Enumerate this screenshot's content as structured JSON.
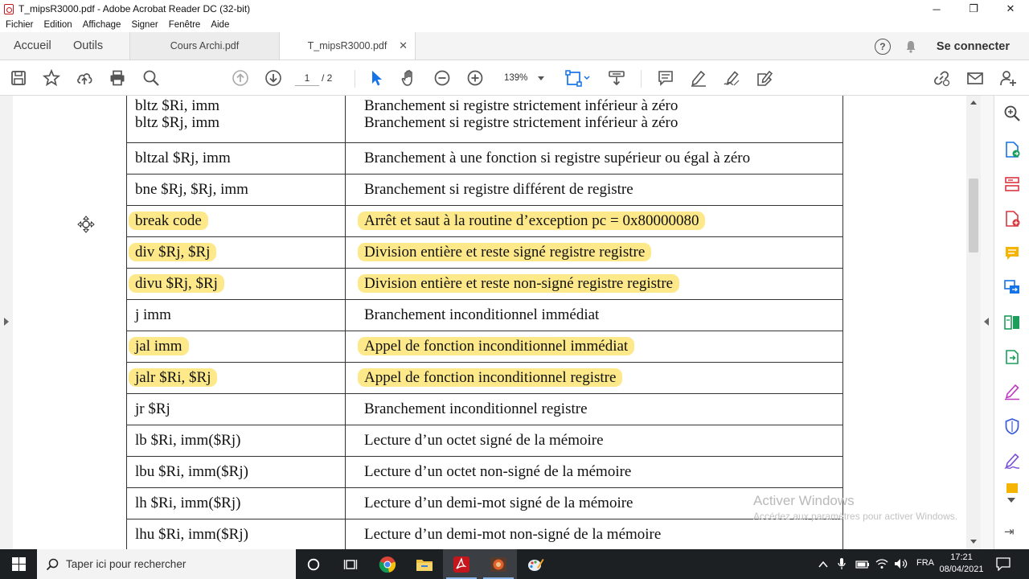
{
  "window": {
    "title": "T_mipsR3000.pdf - Adobe Acrobat Reader DC (32-bit)",
    "minimize": "─",
    "restore": "❐",
    "close": "✕"
  },
  "menu": [
    "Fichier",
    "Edition",
    "Affichage",
    "Signer",
    "Fenêtre",
    "Aide"
  ],
  "tabs": {
    "home": "Accueil",
    "tools": "Outils",
    "doc1": "Cours Archi.pdf",
    "doc2": "T_mipsR3000.pdf",
    "doc2_close": "✕",
    "help": "?",
    "signin": "Se connecter"
  },
  "toolbar": {
    "page_current": "1",
    "page_total": "/ 2",
    "zoom": "139%"
  },
  "table": {
    "rows": [
      {
        "instr": "bltz $Ri, imm",
        "instr2": "bltz $Rj, imm",
        "desc": "Branchement si registre strictement inférieur à zéro",
        "desc2": "Branchement si registre strictement inférieur à zéro",
        "hl": false
      },
      {
        "instr": "bltzal $Rj, imm",
        "desc": "Branchement à une fonction si registre supérieur ou égal à zéro",
        "hl": false
      },
      {
        "instr": "bne $Rj, $Rj, imm",
        "desc": "Branchement si registre différent de registre",
        "hl": false
      },
      {
        "instr": "break code",
        "desc": "Arrêt et saut à la routine d’exception   pc =  0x80000080",
        "hl": true
      },
      {
        "instr": "div $Rj, $Rj",
        "desc": "Division entière et reste signé registre registre",
        "hl": true
      },
      {
        "instr": "divu $Rj, $Rj",
        "desc": "Division entière et reste non-signé registre registre",
        "hl": true
      },
      {
        "instr": "j imm",
        "desc": "Branchement inconditionnel immédiat",
        "hl": false
      },
      {
        "instr": "jal imm",
        "desc": "Appel de fonction inconditionnel immédiat",
        "hl": true
      },
      {
        "instr": "jalr $Ri, $Rj",
        "desc": "Appel de fonction inconditionnel registre",
        "hl": true
      },
      {
        "instr": "jr $Rj",
        "desc": "Branchement inconditionnel registre",
        "hl": false
      },
      {
        "instr": "lb $Ri, imm($Rj)",
        "desc": "Lecture d’un octet signé de la mémoire",
        "hl": false
      },
      {
        "instr": "lbu $Ri, imm($Rj)",
        "desc": "Lecture d’un octet non-signé de la mémoire",
        "hl": false
      },
      {
        "instr": "lh $Ri, imm($Rj)",
        "desc": "Lecture d’un demi-mot signé de la mémoire",
        "hl": false
      },
      {
        "instr": "lhu $Ri, imm($Rj)",
        "desc": "Lecture d’un demi-mot non-signé de la mémoire",
        "hl": false
      }
    ]
  },
  "watermark": {
    "line1": "Activer Windows",
    "line2": "Accédez aux paramètres pour activer Windows."
  },
  "taskbar": {
    "search_placeholder": "Taper ici pour rechercher",
    "lang": "FRA",
    "time": "17:21",
    "date": "08/04/2021"
  },
  "colors": {
    "highlight": "#fde98a",
    "accent_blue": "#1473e6",
    "acrobat_red": "#c4161c",
    "taskbar": "#1d2023"
  }
}
